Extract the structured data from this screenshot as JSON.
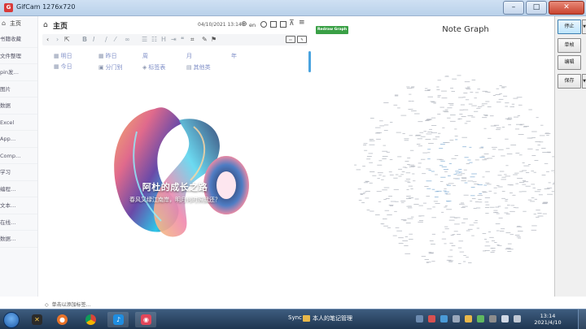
{
  "window": {
    "title": "GifCam 1276x720"
  },
  "sidebar": {
    "home_label": "主页",
    "items": [
      "书籍收藏",
      "文件整理",
      "pin发…",
      "图片",
      "数据",
      "Excel",
      "App…",
      "Comp…",
      "学习",
      "编程…",
      "文本…",
      "在线…",
      "数据…"
    ]
  },
  "note": {
    "title": "主页",
    "date": "04/10/2021 13:14",
    "language": "en"
  },
  "quick_links": {
    "row1": [
      "明日",
      "昨日",
      "周",
      "月",
      "年"
    ],
    "row2": [
      "今日"
    ],
    "row3": [
      "分门别",
      "标签表",
      "其他类"
    ]
  },
  "banner": {
    "title": "阿杜的成长之路",
    "subtitle": "春风又绿江南岸，明月何时照我还？"
  },
  "label_hint": "单击以添加标签...",
  "graph": {
    "redraw_label": "Redraw Graph",
    "title": "Note Graph"
  },
  "gifcam": {
    "record_label": "停止",
    "frame_label": "单帧",
    "edit_label": "编辑",
    "save_label": "保存"
  },
  "taskbar": {
    "app_label": "Sync",
    "window_label": "本人的笔记管理",
    "clock_time": "13:14",
    "clock_date": "2021/4/10"
  },
  "colors": {
    "accent": "#4aa3df",
    "redraw_button": "#3aa046",
    "link": "#8090c8"
  }
}
